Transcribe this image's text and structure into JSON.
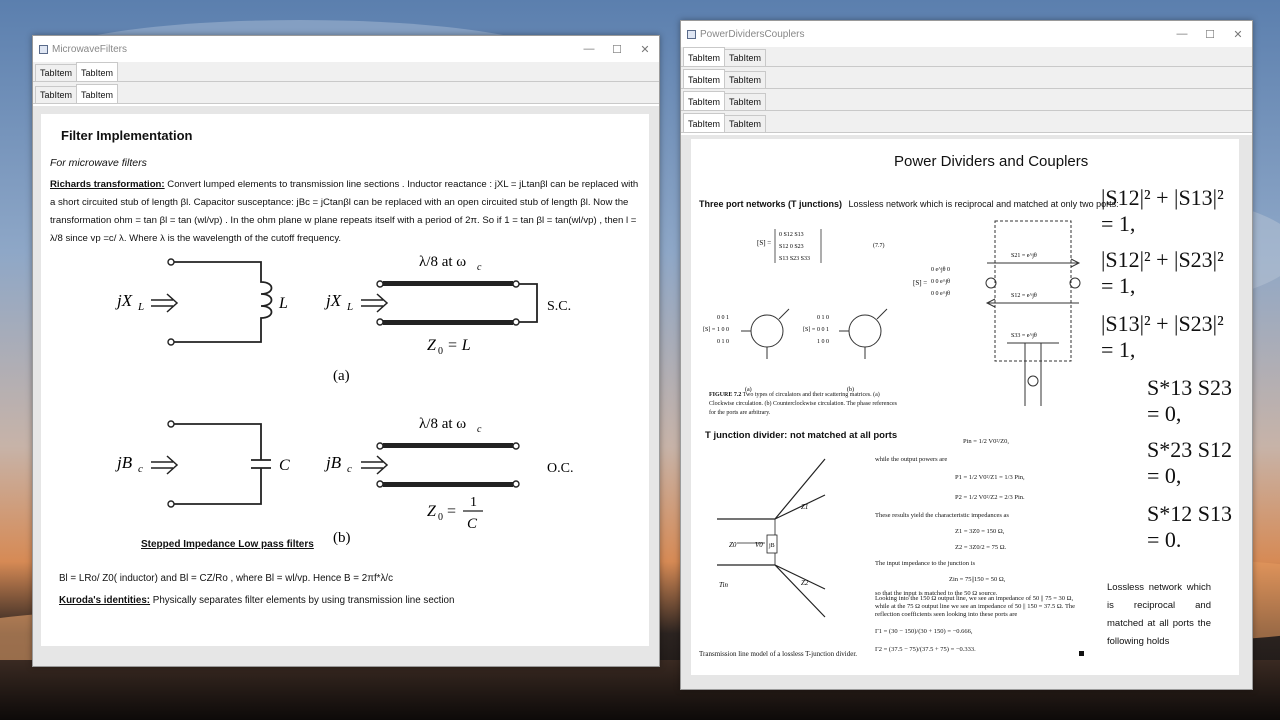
{
  "left_window": {
    "title": "MicrowaveFilters",
    "tabs_row1": [
      "TabItem",
      "TabItem"
    ],
    "tabs_row2": [
      "TabItem",
      "TabItem"
    ],
    "heading": "Filter Implementation",
    "subheading": "For microwave filters",
    "richards_label": "Richards transformation:",
    "richards_text": "Convert lumped elements to transmission line sections . Inductor reactance : jXL = jLtanβl can be replaced with a short circuited stub of length βl. Capacitor susceptance: jBc = jCtanβl can be replaced with an open circuited stub of length βl. Now the transformation ohm = tan βl = tan (wl/vp) . In the ohm plane w plane repeats itself with a period of 2π. So if 1 = tan βl = tan(wl/vp) , then l = λ/8 since vp =c/ λ. Where λ is the wavelength of the cutoff frequency.",
    "fig_a": {
      "jxl": "jX_L",
      "L": "L",
      "lambda": "λ/8 at ω_c",
      "sc": "S.C.",
      "z0": "Z_0 = L",
      "caption": "(a)"
    },
    "fig_b": {
      "jbc": "jB_c",
      "C": "C",
      "lambda": "λ/8 at ω_c",
      "oc": "O.C.",
      "z0": "Z_0 =",
      "num": "1",
      "den": "C",
      "caption": "(b)"
    },
    "stepped_title": "Stepped Impedance Low pass filters",
    "stepped_text": "Bl = LRo/ Z0( inductor) and Bl = CZ/Ro , where Bl = wl/vp. Hence B = 2πf*λ/c",
    "kuroda_label": "Kuroda's identities:",
    "kuroda_text": "Physically separates filter elements by using transmission line section"
  },
  "right_window": {
    "title": "PowerDividersCouplers",
    "tabs": [
      "TabItem",
      "TabItem"
    ],
    "heading": "Power Dividers and Couplers",
    "three_port_label": "Three port networks (T junctions)",
    "three_port_text": "Lossless network which is reciprocal and matched at only two ports:",
    "eq_number": "(7.7)",
    "figure_caption_bold": "FIGURE 7.2",
    "figure_caption": "Two types of circulators and their scattering matrices. (a) Clockwise circulation. (b) Counterclockwise circulation. The phase references for the ports are arbitrary.",
    "circ_a": "(a)",
    "circ_b": "(b)",
    "s21": "S21 = e^jθ",
    "s12": "S12 = e^jθ",
    "s33": "S33 = e^jθ",
    "equations": [
      "|S12|² + |S13|² = 1,",
      "|S12|² + |S23|² = 1,",
      "|S13|² + |S23|² = 1,",
      "S*13 S23 = 0,",
      "S*23 S12 = 0,",
      "S*12 S13 = 0."
    ],
    "tjunction_label": "T junction divider: not matched at all ports",
    "tj_caption": "Transmission line model of a lossless T-junction divider.",
    "pin_eq": "Pin = 1/2 V0²/Z0,",
    "output_powers": "while the output powers are",
    "p1_eq": "P1 = 1/2 V0²/Z1 = 1/3 Pin,",
    "p2_eq": "P2 = 1/2 V0²/Z2 = 2/3 Pin.",
    "char_imp": "These results yield the characteristic impedances as",
    "z1_eq": "Z1 = 3Z0 = 150 Ω,",
    "z2_eq": "Z2 = 3Z0/2 = 75 Ω.",
    "input_imp": "The input impedance to the junction is",
    "zin_eq": "Zin = 75||150 = 50 Ω,",
    "matched_text": "so that the input is matched to the 50 Ω source.",
    "looking_text": "Looking into the 150 Ω output line, we see an impedance of 50 || 75 = 30 Ω, while at the 75 Ω output line we see an impedance of 50 || 150 = 37.5 Ω. The reflection coefficients seen looking into these ports are",
    "g1_eq": "Γ1 = (30 − 150)/(30 + 150) = −0.666,",
    "g2_eq": "Γ2 = (37.5 − 75)/(37.5 + 75) = −0.333.",
    "lossless_text": "Lossless network which is reciprocal and matched at all ports the following holds"
  }
}
